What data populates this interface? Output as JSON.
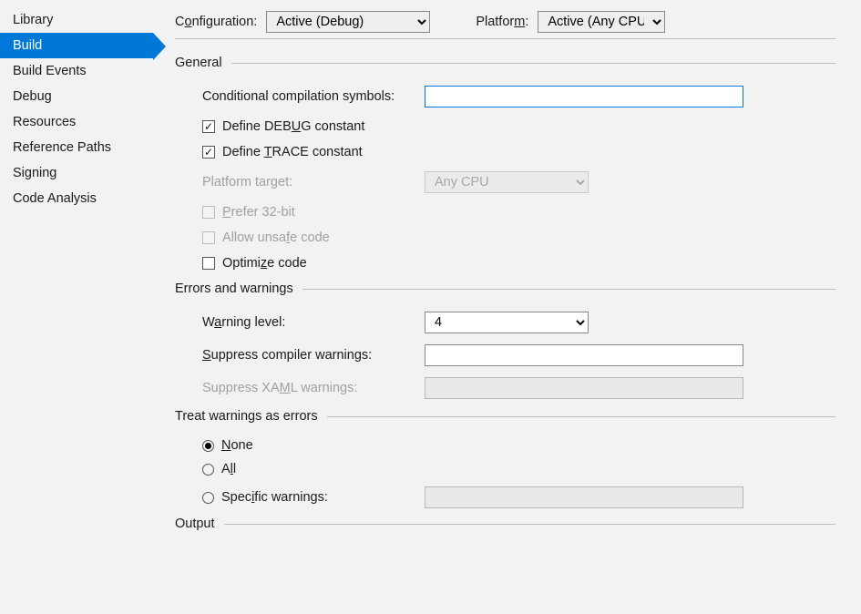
{
  "sidebar": {
    "items": [
      {
        "label": "Library",
        "selected": false
      },
      {
        "label": "Build",
        "selected": true
      },
      {
        "label": "Build Events",
        "selected": false
      },
      {
        "label": "Debug",
        "selected": false
      },
      {
        "label": "Resources",
        "selected": false
      },
      {
        "label": "Reference Paths",
        "selected": false
      },
      {
        "label": "Signing",
        "selected": false
      },
      {
        "label": "Code Analysis",
        "selected": false
      }
    ]
  },
  "top": {
    "config_label_pre": "C",
    "config_label_u": "o",
    "config_label_post": "nfiguration:",
    "config_value": "Active (Debug)",
    "platform_label_pre": "Platfor",
    "platform_label_u": "m",
    "platform_label_post": ":",
    "platform_value": "Active (Any CPU)"
  },
  "general": {
    "title": "General",
    "cond_label": "Conditional compilation symbols:",
    "cond_value": "",
    "debug_pre": "Define DEB",
    "debug_u": "U",
    "debug_post": "G constant",
    "debug_checked": true,
    "trace_pre": "Define ",
    "trace_u": "T",
    "trace_post": "RACE constant",
    "trace_checked": true,
    "ptarget_label": "Platform target:",
    "ptarget_value": "Any CPU",
    "p32_pre": "",
    "p32_u": "P",
    "p32_post": "refer 32-bit",
    "unsafe_pre": "Allow unsa",
    "unsafe_u": "f",
    "unsafe_post": "e code",
    "opt_pre": "Optimi",
    "opt_u": "z",
    "opt_post": "e code",
    "opt_checked": false
  },
  "errors": {
    "title": "Errors and warnings",
    "wlevel_pre": "W",
    "wlevel_u": "a",
    "wlevel_post": "rning level:",
    "wlevel_value": "4",
    "supp_pre": "",
    "supp_u": "S",
    "supp_post": "uppress compiler warnings:",
    "supp_value": "",
    "xaml_pre": "Suppress XA",
    "xaml_u": "M",
    "xaml_post": "L warnings:",
    "xaml_value": ""
  },
  "treat": {
    "title": "Treat warnings as errors",
    "none_pre": "",
    "none_u": "N",
    "none_post": "one",
    "all_pre": "A",
    "all_u": "l",
    "all_post": "l",
    "spec_pre": "Spec",
    "spec_u": "i",
    "spec_post": "fic warnings:",
    "spec_value": "",
    "selected": "none"
  },
  "output": {
    "title": "Output"
  }
}
